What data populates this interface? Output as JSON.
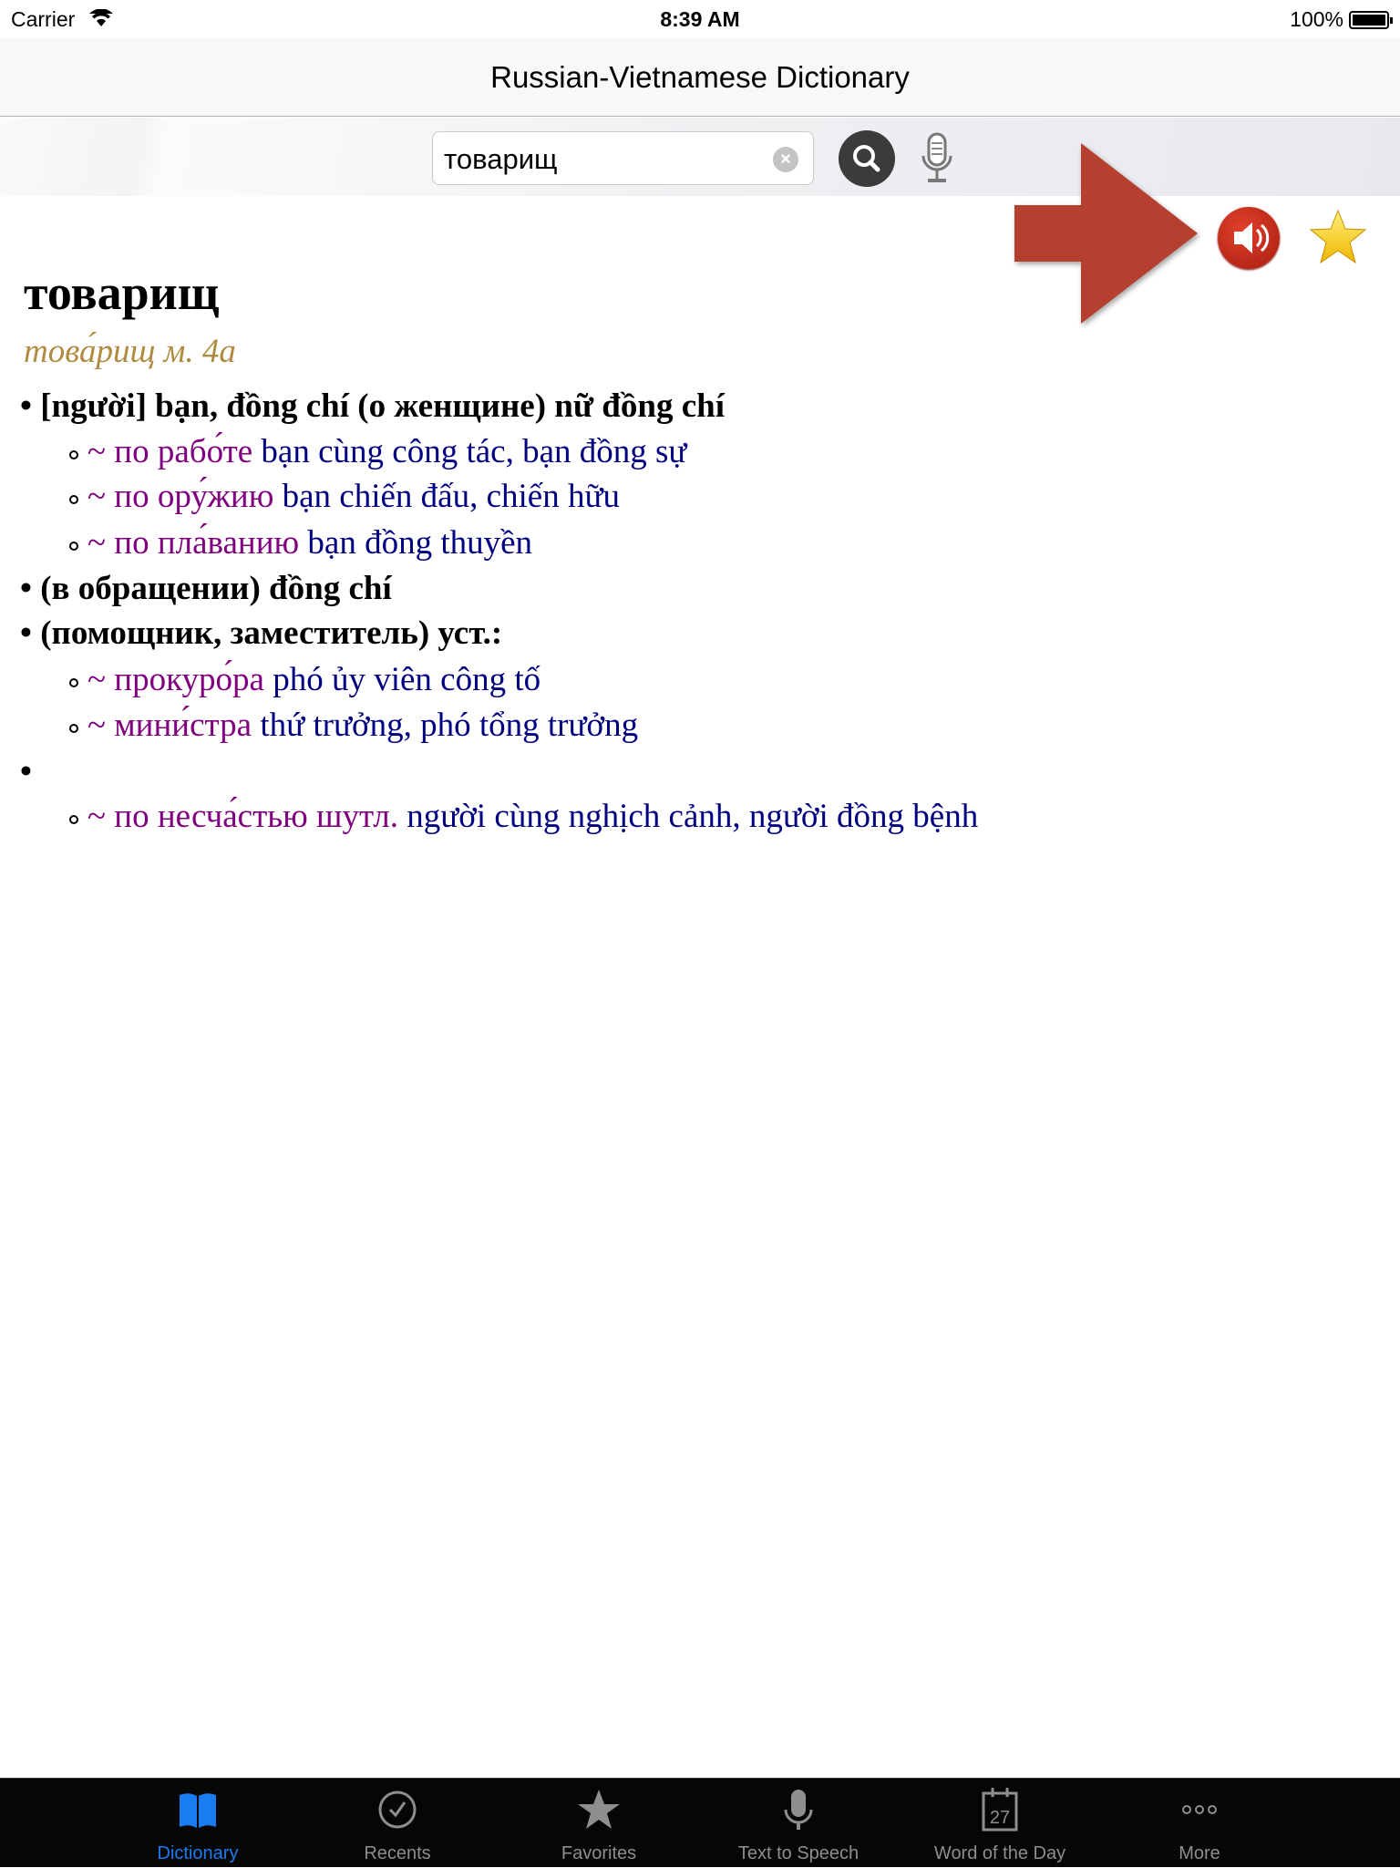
{
  "status": {
    "carrier": "Carrier",
    "time": "8:39 AM",
    "battery": "100%"
  },
  "nav": {
    "title": "Russian-Vietnamese Dictionary"
  },
  "toolbar": {
    "search_value": "товарищ",
    "search_placeholder": "",
    "clear_icon": "clear-icon",
    "search_icon": "magnifier-icon",
    "mic_icon": "microphone-icon"
  },
  "actions": {
    "speak_icon": "speaker-icon",
    "favorite_icon": "star-icon",
    "annotation_arrow_color": "#b5402f"
  },
  "entry": {
    "headword": "товарищ",
    "grammar": "това́рищ м. 4а",
    "lines": [
      {
        "level": 1,
        "text": "[người] bạn, đồng chí (о женщине) nữ đồng chí"
      },
      {
        "level": 2,
        "ru": "~ по рабо́те",
        "vi": "bạn cùng công tác, bạn đồng sự"
      },
      {
        "level": 2,
        "ru": "~ по ору́жию",
        "vi": "bạn chiến đấu, chiến hữu"
      },
      {
        "level": 2,
        "ru": "~ по пла́ванию",
        "vi": "bạn đồng thuyền"
      },
      {
        "level": 1,
        "text": "(в обращении) đồng chí"
      },
      {
        "level": 1,
        "text": "(помощник, заместитель) уст.:"
      },
      {
        "level": 2,
        "ru": "~ прокуро́ра",
        "vi": "phó ủy viên công tố"
      },
      {
        "level": 2,
        "ru": "~ мини́стра",
        "vi": "thứ trưởng, phó tổng trưởng"
      },
      {
        "level": 1,
        "text": ""
      },
      {
        "level": 2,
        "ru": "~ по несча́стью шутл.",
        "vi": "người cùng nghịch cảnh, người đồng bệnh"
      }
    ]
  },
  "tabs": [
    {
      "label": "Dictionary",
      "icon": "book-icon",
      "active": true
    },
    {
      "label": "Recents",
      "icon": "clock-check-icon"
    },
    {
      "label": "Favorites",
      "icon": "star-icon"
    },
    {
      "label": "Text to Speech",
      "icon": "microphone-icon"
    },
    {
      "label": "Word of the Day",
      "icon": "calendar-icon",
      "badge": "27"
    },
    {
      "label": "More",
      "icon": "more-icon"
    }
  ],
  "colors": {
    "active_tab": "#1a7cf3",
    "russian": "#800080",
    "vietnamese": "#000080",
    "grammar": "#b08a3e"
  }
}
